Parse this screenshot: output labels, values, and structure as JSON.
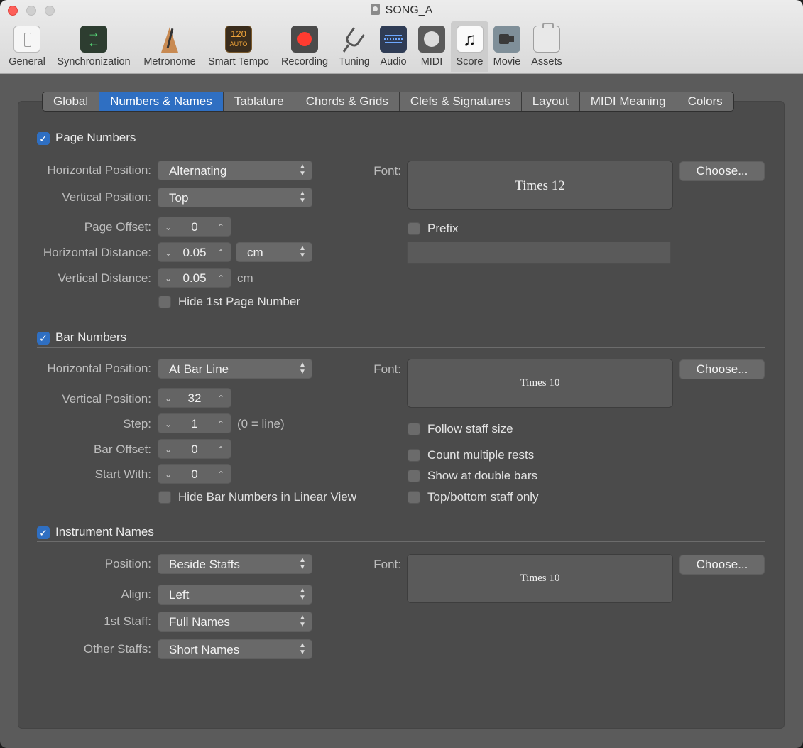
{
  "window": {
    "title": "SONG_A"
  },
  "toolbar": [
    {
      "label": "General",
      "icon": "general-icon"
    },
    {
      "label": "Synchronization",
      "icon": "synchronization-icon"
    },
    {
      "label": "Metronome",
      "icon": "metronome-icon"
    },
    {
      "label": "Smart Tempo",
      "icon": "smart-tempo-icon",
      "icon_text": "120",
      "icon_subtext": "AUTO"
    },
    {
      "label": "Recording",
      "icon": "record-icon"
    },
    {
      "label": "Tuning",
      "icon": "tuning-fork-icon"
    },
    {
      "label": "Audio",
      "icon": "audio-waveform-icon"
    },
    {
      "label": "MIDI",
      "icon": "midi-connector-icon"
    },
    {
      "label": "Score",
      "icon": "score-note-icon",
      "active": true
    },
    {
      "label": "Movie",
      "icon": "movie-camera-icon"
    },
    {
      "label": "Assets",
      "icon": "assets-briefcase-icon"
    }
  ],
  "tabs": [
    "Global",
    "Numbers & Names",
    "Tablature",
    "Chords & Grids",
    "Clefs & Signatures",
    "Layout",
    "MIDI Meaning",
    "Colors"
  ],
  "active_tab": "Numbers & Names",
  "accent_color": "#2f6fc2",
  "page_numbers": {
    "title": "Page Numbers",
    "checked": true,
    "horizontal_position_label": "Horizontal Position:",
    "horizontal_position": "Alternating",
    "vertical_position_label": "Vertical Position:",
    "vertical_position": "Top",
    "page_offset_label": "Page Offset:",
    "page_offset": "0",
    "horizontal_distance_label": "Horizontal Distance:",
    "horizontal_distance": "0.05",
    "horizontal_distance_unit": "cm",
    "vertical_distance_label": "Vertical Distance:",
    "vertical_distance": "0.05",
    "vertical_distance_unit": "cm",
    "hide_first_label": "Hide 1st Page Number",
    "font_label": "Font:",
    "font": "Times 12",
    "choose_label": "Choose...",
    "prefix_label": "Prefix",
    "prefix_value": ""
  },
  "bar_numbers": {
    "title": "Bar Numbers",
    "checked": true,
    "horizontal_position_label": "Horizontal Position:",
    "horizontal_position": "At Bar Line",
    "vertical_position_label": "Vertical Position:",
    "vertical_position": "32",
    "step_label": "Step:",
    "step": "1",
    "step_note": "(0 = line)",
    "bar_offset_label": "Bar Offset:",
    "bar_offset": "0",
    "start_with_label": "Start With:",
    "start_with": "0",
    "hide_linear_label": "Hide Bar Numbers in Linear View",
    "font_label": "Font:",
    "font": "Times 10",
    "choose_label": "Choose...",
    "follow_staff_size_label": "Follow staff size",
    "count_multiple_rests_label": "Count multiple rests",
    "show_double_bars_label": "Show at double bars",
    "top_bottom_only_label": "Top/bottom staff only"
  },
  "instrument_names": {
    "title": "Instrument Names",
    "checked": true,
    "position_label": "Position:",
    "position": "Beside Staffs",
    "align_label": "Align:",
    "align": "Left",
    "first_staff_label": "1st Staff:",
    "first_staff": "Full Names",
    "other_staffs_label": "Other Staffs:",
    "other_staffs": "Short Names",
    "font_label": "Font:",
    "font": "Times 10",
    "choose_label": "Choose..."
  }
}
